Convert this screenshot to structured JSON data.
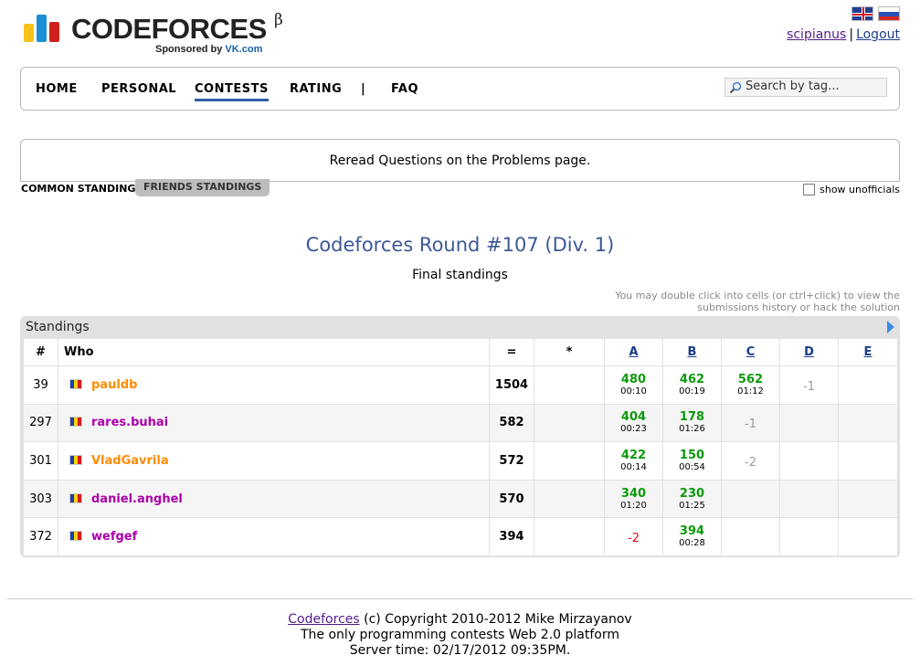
{
  "header": {
    "logo_text": "CODEFORCES",
    "logo_beta": "β",
    "sponsor_prefix": "Sponsored by ",
    "sponsor_name": "VK.com",
    "username": "scipianus",
    "separator": "|",
    "logout": "Logout",
    "flags": [
      "uk-flag-icon",
      "russia-flag-icon"
    ]
  },
  "menu": {
    "items": [
      "HOME",
      "PERSONAL",
      "CONTESTS",
      "RATING",
      "|",
      "FAQ"
    ],
    "active": "CONTESTS",
    "search_placeholder": "Search by tag..."
  },
  "notice": "Reread Questions on the Problems page.",
  "tabs": {
    "common": "COMMON STANDINGS",
    "friends": "FRIENDS STANDINGS",
    "unofficial": "show unofficials"
  },
  "contest": {
    "title": "Codeforces Round #107 (Div. 1)",
    "status": "Final standings",
    "hint_line1": "You may double click into cells (or ctrl+click) to view the",
    "hint_line2": "submissions history or hack the solution"
  },
  "standings": {
    "caption": "Standings",
    "headers": [
      "#",
      "Who",
      "=",
      "*",
      "A",
      "B",
      "C",
      "D",
      "E"
    ],
    "rows": [
      {
        "rank": "39",
        "who": "pauldb",
        "color": "#ff8c00",
        "points": "1504",
        "cells": [
          {
            "score": "480",
            "time": "00:10"
          },
          {
            "score": "462",
            "time": "00:19"
          },
          {
            "score": "562",
            "time": "01:12"
          },
          {
            "rej": "-1",
            "grey": true
          },
          {}
        ]
      },
      {
        "rank": "297",
        "who": "rares.buhai",
        "color": "#a0a",
        "points": "582",
        "cells": [
          {
            "score": "404",
            "time": "00:23"
          },
          {
            "score": "178",
            "time": "01:26"
          },
          {
            "rej": "-1",
            "grey": true
          },
          {},
          {}
        ]
      },
      {
        "rank": "301",
        "who": "VladGavrila",
        "color": "#ff8c00",
        "points": "572",
        "cells": [
          {
            "score": "422",
            "time": "00:14"
          },
          {
            "score": "150",
            "time": "00:54"
          },
          {
            "rej": "-2",
            "grey": true
          },
          {},
          {}
        ]
      },
      {
        "rank": "303",
        "who": "daniel.anghel",
        "color": "#a0a",
        "points": "570",
        "cells": [
          {
            "score": "340",
            "time": "01:20"
          },
          {
            "score": "230",
            "time": "01:25"
          },
          {},
          {},
          {}
        ]
      },
      {
        "rank": "372",
        "who": "wefgef",
        "color": "#a0a",
        "points": "394",
        "cells": [
          {
            "rej": "-2",
            "grey": false
          },
          {
            "score": "394",
            "time": "00:28"
          },
          {},
          {},
          {}
        ]
      }
    ]
  },
  "footer": {
    "link": "Codeforces",
    "copyright": " (c) Copyright 2010-2012 Mike Mirzayanov",
    "tagline": "The only programming contests Web 2.0 platform",
    "server_time": "Server time: 02/17/2012 09:35PM."
  },
  "colors": {
    "accent": "#3b5998",
    "accepted": "#0a9a0a",
    "rejected": "#dd1111",
    "orange_user": "#ff8c00",
    "purple_user": "#aa00aa"
  }
}
